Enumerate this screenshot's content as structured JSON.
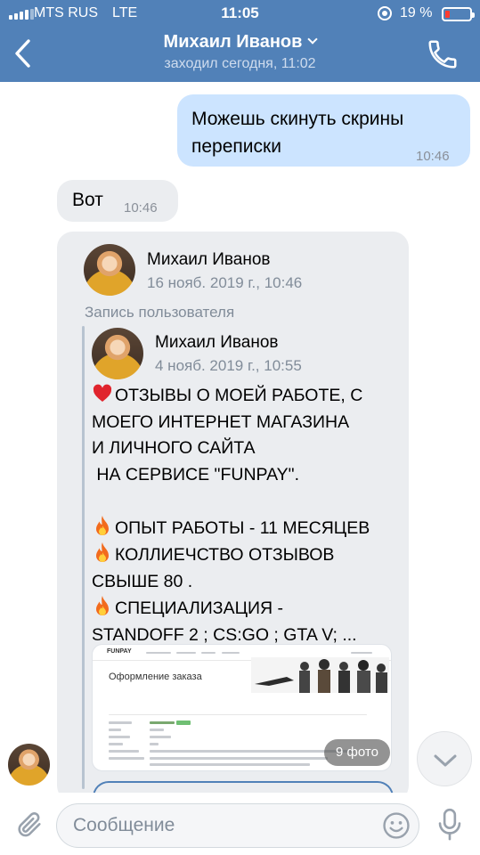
{
  "status_bar": {
    "carrier": "MTS RUS",
    "network": "LTE",
    "time": "11:05",
    "battery_percent": "19 %",
    "battery_level": 0.19
  },
  "header": {
    "title": "Михаил Иванов",
    "subtitle": "заходил сегодня, 11:02"
  },
  "messages": [
    {
      "direction": "out",
      "text_lines": [
        "Можешь скинуть скрины",
        "переписки"
      ],
      "time": "10:46"
    },
    {
      "direction": "in",
      "text": "Вот",
      "time": "10:46"
    }
  ],
  "repost": {
    "author": "Михаил Иванов",
    "date": "16 нояб. 2019 г., 10:46",
    "label": "Запись пользователя",
    "original_author": "Михаил Иванов",
    "original_date": "4 нояб. 2019 г., 10:55",
    "lines": [
      {
        "icon": "heart",
        "text": "ОТЗЫВЫ О МОЕЙ РАБОТЕ, С"
      },
      {
        "icon": "",
        "text": "МОЕГО ИНТЕРНЕТ МАГАЗИНА"
      },
      {
        "icon": "",
        "text": "И ЛИЧНОГО САЙТА"
      },
      {
        "icon": "",
        "text": " НА СЕРВИСЕ \"FUNPAY\"."
      },
      {
        "icon": "",
        "text": ""
      },
      {
        "icon": "fire",
        "text": "ОПЫТ РАБОТЫ - 11 МЕСЯЦЕВ"
      },
      {
        "icon": "fire",
        "text": "КОЛЛИЕЧСТВО ОТЗЫВОВ"
      },
      {
        "icon": "",
        "text": "СВЫШЕ 80 ."
      },
      {
        "icon": "fire",
        "text": "СПЕЦИАЛИЗАЦИЯ -"
      },
      {
        "icon": "",
        "text": "STANDOFF 2 ; CS:GO ; GTA V; ..."
      }
    ],
    "photo": {
      "brand": "FUNPAY",
      "heading": "Оформление заказа",
      "count_label": "9 фото"
    }
  },
  "composer": {
    "placeholder": "Сообщение"
  },
  "colors": {
    "header": "#5181b8",
    "outgoing_bubble": "#cce4ff",
    "incoming_bubble": "#ebedf0",
    "secondary_text": "#818c99"
  },
  "icons": [
    "back-icon",
    "chevron-down-icon",
    "phone-icon",
    "heart-icon",
    "fire-icon",
    "paperclip-icon",
    "smile-icon",
    "microphone-icon"
  ]
}
